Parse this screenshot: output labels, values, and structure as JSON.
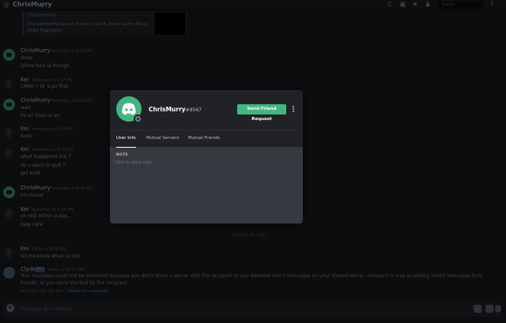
{
  "topbar": {
    "channel_name": "ChrisMurry",
    "search_placeholder": "Search"
  },
  "embed": {
    "provider": "Chrismurray",
    "description": "Thatsdelightful Grand Master's Gill & Trunk Game Beta | OSRS Highlights"
  },
  "messages": [
    {
      "author": "ChrisMurry",
      "time": "Yesterday at 4:12 PM",
      "lines": [
        "done",
        "10hrs fuck is though"
      ],
      "avatar": "discord"
    },
    {
      "author": "Kei",
      "time": "Yesterday at 4:15 PM",
      "lines": [
        "LMAO ? Or a go first"
      ],
      "avatar": "kei"
    },
    {
      "author": "ChrisMurry",
      "time": "Yesterday at 4:20 PM",
      "lines": [
        "wait",
        "its an hour or so"
      ],
      "avatar": "discord"
    },
    {
      "author": "Kei",
      "time": "Yesterday at 4:25 PM",
      "lines": [
        "Sure"
      ],
      "avatar": "kei"
    },
    {
      "author": "Kei",
      "time": "Yesterday at 4:30 PM",
      "lines": [
        "what happened bro ?",
        "do u want to quit ?",
        "get knot"
      ],
      "avatar": "kei"
    },
    {
      "author": "ChrisMurry",
      "time": "Yesterday at 4:40 PM",
      "lines": [
        "i'm tiured"
      ],
      "avatar": "discord"
    },
    {
      "author": "Kei",
      "time": "Yesterday at 4:45 PM",
      "lines": [
        "ok rest within a say...",
        "take care"
      ],
      "avatar": "kei"
    },
    {
      "author": "Kei",
      "time": "Today at 9:58 AM",
      "lines": [
        "let me know when ur out"
      ],
      "avatar": "kei"
    }
  ],
  "date_divider": "January 14, 2021",
  "clyde": {
    "author": "Clyde",
    "bot_tag": "BOT",
    "time": "Today at 10:02 AM",
    "text": "Your message could not be delivered because you don't share a server with the recipient or you disabled direct messages on your shared server, recipient is only accepting direct messages from friends, or you were blocked by the recipient.",
    "note": "Only you can see this •",
    "note_link": "Delete this message"
  },
  "chat": {
    "placeholder": "Message @ChrisMurry"
  },
  "modal": {
    "username": "ChrisMurry",
    "discriminator": "#8567",
    "friend_button": "Send Friend Request",
    "tabs": [
      "User Info",
      "Mutual Servers",
      "Mutual Friends"
    ],
    "note_label": "NOTE",
    "note_placeholder": "Click to add a note"
  },
  "colors": {
    "accent_green": "#43b581",
    "modal_bg": "#36393f",
    "header_bg": "#202225",
    "overlay": "#0c0d0e"
  }
}
